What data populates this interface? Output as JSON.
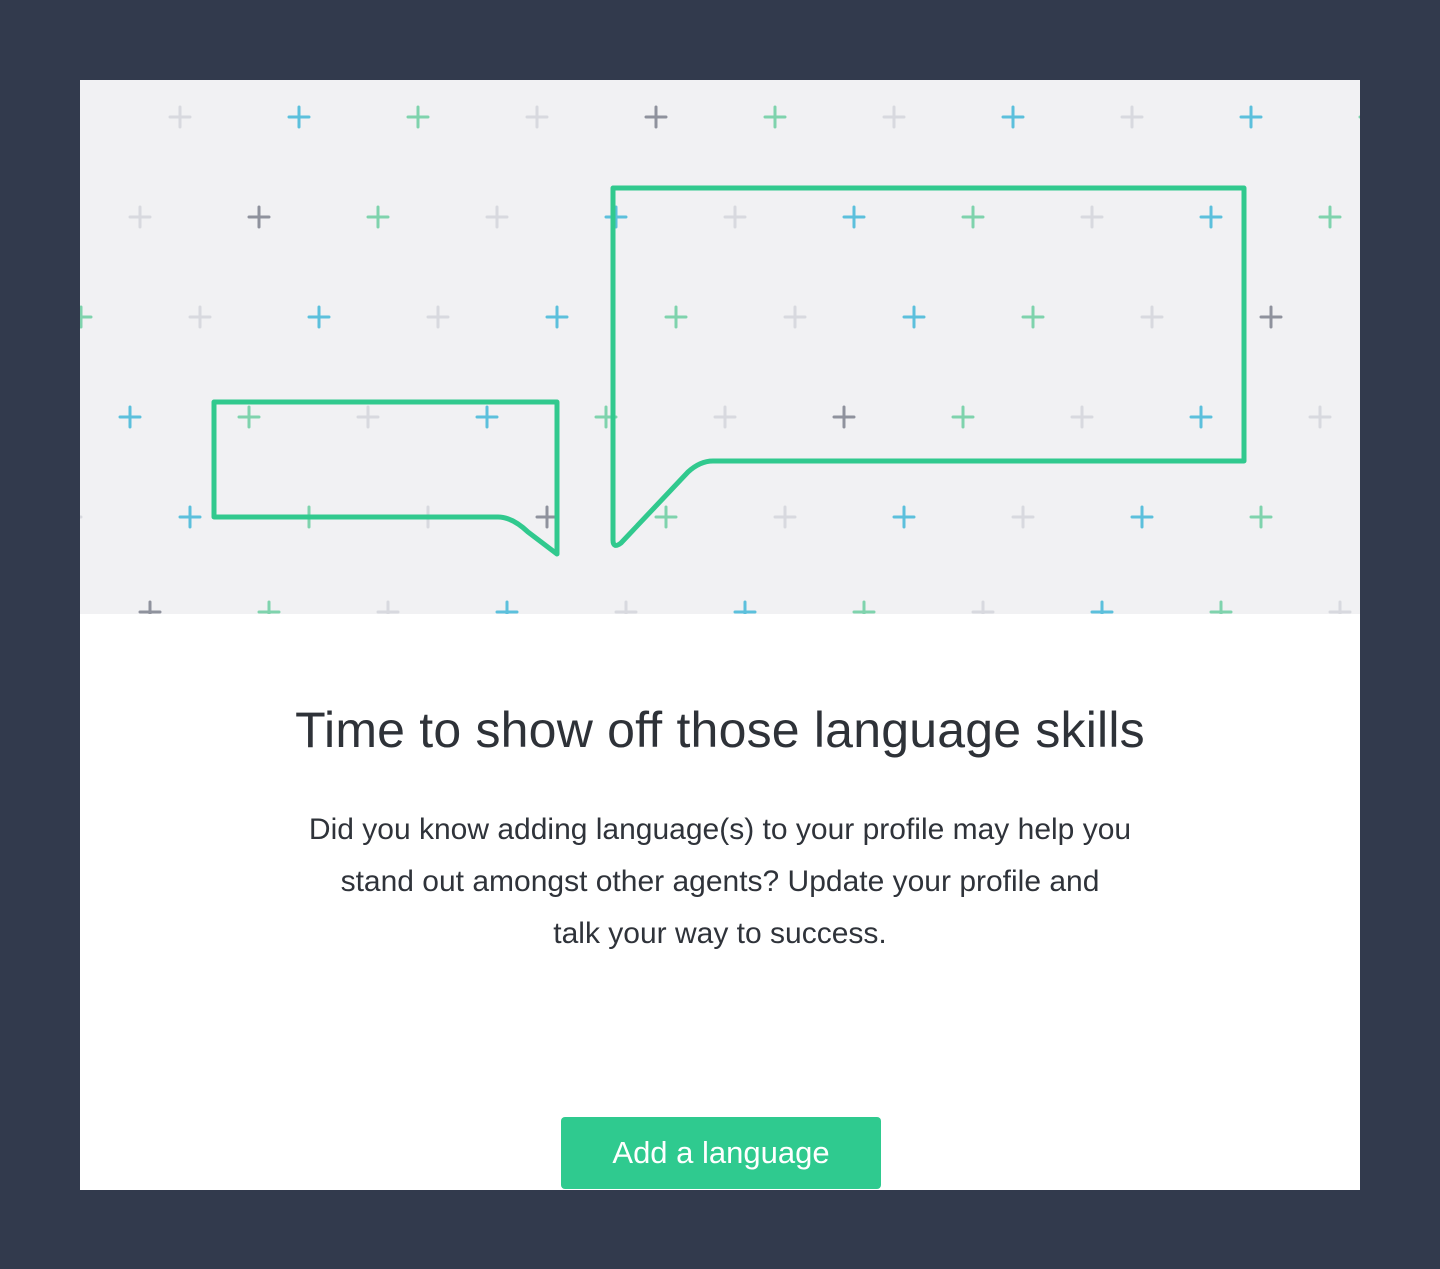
{
  "hero": {
    "illustration": "speech-bubbles-on-plus-pattern",
    "colors": {
      "background": "#f1f1f3",
      "bubble_outline": "#31c98e",
      "plus_green": "#7fd3ad",
      "plus_blue": "#5cc0dc",
      "plus_gray": "#d8d9df",
      "plus_dark": "#8f929d"
    }
  },
  "content": {
    "headline": "Time to show off those language skills",
    "body": "Did you know adding language(s) to your profile may help you\nstand out amongst other agents? Update your profile and\ntalk your way to success.",
    "cta_label": "Add a language"
  },
  "colors": {
    "page_background": "#323a4d",
    "card_background": "#ffffff",
    "accent": "#2fca8f",
    "text": "#2e3238"
  }
}
